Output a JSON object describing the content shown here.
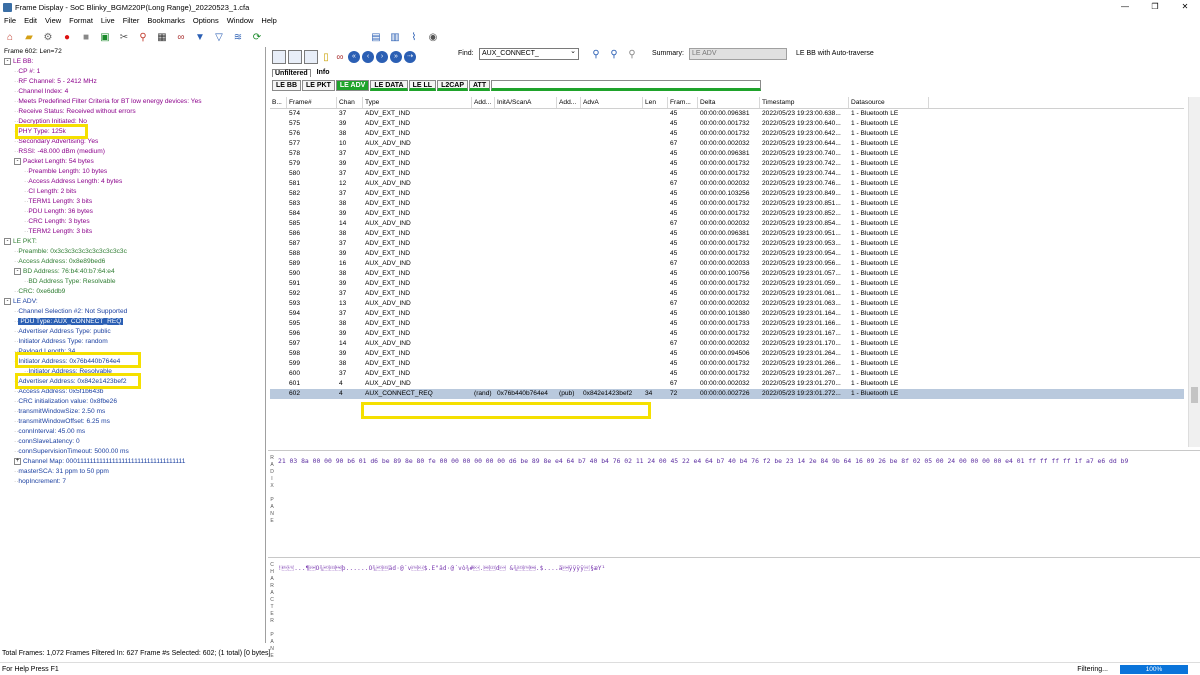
{
  "window": {
    "title": "Frame Display - SoC Blinky_BGM220P(Long Range)_20220523_1.cfa",
    "minimize": "—",
    "maximize": "❐",
    "close": "✕"
  },
  "menu": [
    "File",
    "Edit",
    "View",
    "Format",
    "Live",
    "Filter",
    "Bookmarks",
    "Options",
    "Window",
    "Help"
  ],
  "toolbar_icons": [
    "home-icon",
    "open-folder-icon",
    "settings-icon",
    "record-icon",
    "stop-icon",
    "save-icon",
    "scissors-icon",
    "search-icon",
    "table-icon",
    "binoculars-icon",
    "filter-icon",
    "filter-clear-icon",
    "layers-icon",
    "refresh-icon"
  ],
  "tree": [
    {
      "text": "Frame 602:  Len=72",
      "color": "black",
      "indent": 0,
      "box": ""
    },
    {
      "text": "LE BB:",
      "color": "purple",
      "indent": 0,
      "box": "-"
    },
    {
      "text": "CP #: 1",
      "color": "purple",
      "indent": 1,
      "box": ""
    },
    {
      "text": "RF Channel:  5 - 2412 MHz",
      "color": "purple",
      "indent": 1,
      "box": ""
    },
    {
      "text": "Channel Index:  4",
      "color": "purple",
      "indent": 1,
      "box": ""
    },
    {
      "text": "Meets Predefined Filter Criteria for BT low energy devices: Yes",
      "color": "purple",
      "indent": 1,
      "box": ""
    },
    {
      "text": "Receive Status: Received without errors",
      "color": "purple",
      "indent": 1,
      "box": ""
    },
    {
      "text": "Decryption Initiated: No",
      "color": "purple",
      "indent": 1,
      "box": ""
    },
    {
      "text": "PHY Type: 125k",
      "color": "purple",
      "indent": 1,
      "box": ""
    },
    {
      "text": "Secondary Advertising: Yes",
      "color": "purple",
      "indent": 1,
      "box": ""
    },
    {
      "text": "RSSI: -48.000 dBm (medium)",
      "color": "purple",
      "indent": 1,
      "box": ""
    },
    {
      "text": "Packet Length: 54  bytes",
      "color": "purple",
      "indent": 1,
      "box": "-"
    },
    {
      "text": "Preamble Length: 10 bytes",
      "color": "purple",
      "indent": 2,
      "box": ""
    },
    {
      "text": "Access Address Length: 4 bytes",
      "color": "purple",
      "indent": 2,
      "box": ""
    },
    {
      "text": "CI Length: 2 bits",
      "color": "purple",
      "indent": 2,
      "box": ""
    },
    {
      "text": "TERM1 Length: 3 bits",
      "color": "purple",
      "indent": 2,
      "box": ""
    },
    {
      "text": "PDU Length: 36 bytes",
      "color": "purple",
      "indent": 2,
      "box": ""
    },
    {
      "text": "CRC Length: 3 bytes",
      "color": "purple",
      "indent": 2,
      "box": ""
    },
    {
      "text": "TERM2 Length: 3 bits",
      "color": "purple",
      "indent": 2,
      "box": ""
    },
    {
      "text": "LE PKT:",
      "color": "green",
      "indent": 0,
      "box": "-"
    },
    {
      "text": "Preamble: 0x3c3c3c3c3c3c3c3c3c3c",
      "color": "green",
      "indent": 1,
      "box": ""
    },
    {
      "text": "Access Address: 0x8e89bed6",
      "color": "green",
      "indent": 1,
      "box": ""
    },
    {
      "text": "BD Address: 76:b4:40:b7:64:e4",
      "color": "green",
      "indent": 1,
      "box": "-"
    },
    {
      "text": "BD Address Type: Resolvable",
      "color": "green",
      "indent": 2,
      "box": ""
    },
    {
      "text": "CRC: 0xe6ddb9",
      "color": "green",
      "indent": 1,
      "box": ""
    },
    {
      "text": "LE ADV:",
      "color": "blue",
      "indent": 0,
      "box": "-"
    },
    {
      "text": "Channel Selection #2: Not Supported",
      "color": "blue",
      "indent": 1,
      "box": ""
    },
    {
      "text": "PDU Type: AUX_CONNECT_REQ",
      "color": "blue",
      "indent": 1,
      "box": "",
      "selected": true
    },
    {
      "text": "Advertiser Address Type: public",
      "color": "blue",
      "indent": 1,
      "box": ""
    },
    {
      "text": "Initiator Address Type: random",
      "color": "blue",
      "indent": 1,
      "box": ""
    },
    {
      "text": "Payload Length: 34",
      "color": "blue",
      "indent": 1,
      "box": ""
    },
    {
      "text": "Initiator Address: 0x76b440b764e4",
      "color": "blue",
      "indent": 1,
      "box": ""
    },
    {
      "text": "Initiator Address: Resolvable",
      "color": "blue",
      "indent": 2,
      "box": ""
    },
    {
      "text": "Advertiser Address: 0x842e1423bef2",
      "color": "blue",
      "indent": 1,
      "box": ""
    },
    {
      "text": "Access Address: 0x5f1b643b",
      "color": "blue",
      "indent": 1,
      "box": ""
    },
    {
      "text": "CRC initialization value: 0x8fbe26",
      "color": "blue",
      "indent": 1,
      "box": ""
    },
    {
      "text": "transmitWindowSize: 2.50  ms",
      "color": "blue",
      "indent": 1,
      "box": ""
    },
    {
      "text": "transmitWindowOffset: 6.25  ms",
      "color": "blue",
      "indent": 1,
      "box": ""
    },
    {
      "text": "connInterval: 45.00  ms",
      "color": "blue",
      "indent": 1,
      "box": ""
    },
    {
      "text": "connSlaveLatency: 0",
      "color": "blue",
      "indent": 1,
      "box": ""
    },
    {
      "text": "connSupervisionTimeout: 5000.00  ms",
      "color": "blue",
      "indent": 1,
      "box": ""
    },
    {
      "text": "Channel Map: 0001111111111111111111111111111111111",
      "color": "blue",
      "indent": 1,
      "box": "+"
    },
    {
      "text": "masterSCA: 31 ppm to 50 ppm",
      "color": "blue",
      "indent": 1,
      "box": ""
    },
    {
      "text": "hopIncrement: 7",
      "color": "blue",
      "indent": 1,
      "box": ""
    }
  ],
  "find": {
    "label": "Find:",
    "value": "AUX_CONNECT_"
  },
  "summary": {
    "label": "Summary:",
    "value": "LE ADV",
    "right": "LE BB with Auto-traverse"
  },
  "view_tabs": [
    "Unfiltered",
    "Info"
  ],
  "proto_tabs": [
    "LE BB",
    "LE PKT",
    "LE ADV",
    "LE DATA",
    "LE LL",
    "L2CAP",
    "ATT"
  ],
  "active_proto_tab": "LE ADV",
  "columns": [
    "B...",
    "Frame#",
    "Chan",
    "Type",
    "Add...",
    "InitA/ScanA",
    "Add...",
    "AdvA",
    "Len",
    "Fram...",
    "Delta",
    "Timestamp",
    "Datasource"
  ],
  "rows": [
    [
      "",
      "574",
      "37",
      "ADV_EXT_IND",
      "",
      "",
      "",
      "",
      "",
      "45",
      "00:00:00.096381",
      "2022/05/23 19:23:00.638...",
      "1 - Bluetooth LE"
    ],
    [
      "",
      "575",
      "39",
      "ADV_EXT_IND",
      "",
      "",
      "",
      "",
      "",
      "45",
      "00:00:00.001732",
      "2022/05/23 19:23:00.640...",
      "1 - Bluetooth LE"
    ],
    [
      "",
      "576",
      "38",
      "ADV_EXT_IND",
      "",
      "",
      "",
      "",
      "",
      "45",
      "00:00:00.001732",
      "2022/05/23 19:23:00.642...",
      "1 - Bluetooth LE"
    ],
    [
      "",
      "577",
      "10",
      "AUX_ADV_IND",
      "",
      "",
      "",
      "",
      "",
      "67",
      "00:00:00.002032",
      "2022/05/23 19:23:00.644...",
      "1 - Bluetooth LE"
    ],
    [
      "",
      "578",
      "37",
      "ADV_EXT_IND",
      "",
      "",
      "",
      "",
      "",
      "45",
      "00:00:00.096381",
      "2022/05/23 19:23:00.740...",
      "1 - Bluetooth LE"
    ],
    [
      "",
      "579",
      "39",
      "ADV_EXT_IND",
      "",
      "",
      "",
      "",
      "",
      "45",
      "00:00:00.001732",
      "2022/05/23 19:23:00.742...",
      "1 - Bluetooth LE"
    ],
    [
      "",
      "580",
      "37",
      "ADV_EXT_IND",
      "",
      "",
      "",
      "",
      "",
      "45",
      "00:00:00.001732",
      "2022/05/23 19:23:00.744...",
      "1 - Bluetooth LE"
    ],
    [
      "",
      "581",
      "12",
      "AUX_ADV_IND",
      "",
      "",
      "",
      "",
      "",
      "67",
      "00:00:00.002032",
      "2022/05/23 19:23:00.746...",
      "1 - Bluetooth LE"
    ],
    [
      "",
      "582",
      "37",
      "ADV_EXT_IND",
      "",
      "",
      "",
      "",
      "",
      "45",
      "00:00:00.103256",
      "2022/05/23 19:23:00.849...",
      "1 - Bluetooth LE"
    ],
    [
      "",
      "583",
      "38",
      "ADV_EXT_IND",
      "",
      "",
      "",
      "",
      "",
      "45",
      "00:00:00.001732",
      "2022/05/23 19:23:00.851...",
      "1 - Bluetooth LE"
    ],
    [
      "",
      "584",
      "39",
      "ADV_EXT_IND",
      "",
      "",
      "",
      "",
      "",
      "45",
      "00:00:00.001732",
      "2022/05/23 19:23:00.852...",
      "1 - Bluetooth LE"
    ],
    [
      "",
      "585",
      "14",
      "AUX_ADV_IND",
      "",
      "",
      "",
      "",
      "",
      "67",
      "00:00:00.002032",
      "2022/05/23 19:23:00.854...",
      "1 - Bluetooth LE"
    ],
    [
      "",
      "586",
      "38",
      "ADV_EXT_IND",
      "",
      "",
      "",
      "",
      "",
      "45",
      "00:00:00.096381",
      "2022/05/23 19:23:00.951...",
      "1 - Bluetooth LE"
    ],
    [
      "",
      "587",
      "37",
      "ADV_EXT_IND",
      "",
      "",
      "",
      "",
      "",
      "45",
      "00:00:00.001732",
      "2022/05/23 19:23:00.953...",
      "1 - Bluetooth LE"
    ],
    [
      "",
      "588",
      "39",
      "ADV_EXT_IND",
      "",
      "",
      "",
      "",
      "",
      "45",
      "00:00:00.001732",
      "2022/05/23 19:23:00.954...",
      "1 - Bluetooth LE"
    ],
    [
      "",
      "589",
      "16",
      "AUX_ADV_IND",
      "",
      "",
      "",
      "",
      "",
      "67",
      "00:00:00.002033",
      "2022/05/23 19:23:00.956...",
      "1 - Bluetooth LE"
    ],
    [
      "",
      "590",
      "38",
      "ADV_EXT_IND",
      "",
      "",
      "",
      "",
      "",
      "45",
      "00:00:00.100756",
      "2022/05/23 19:23:01.057...",
      "1 - Bluetooth LE"
    ],
    [
      "",
      "591",
      "39",
      "ADV_EXT_IND",
      "",
      "",
      "",
      "",
      "",
      "45",
      "00:00:00.001732",
      "2022/05/23 19:23:01.059...",
      "1 - Bluetooth LE"
    ],
    [
      "",
      "592",
      "37",
      "ADV_EXT_IND",
      "",
      "",
      "",
      "",
      "",
      "45",
      "00:00:00.001732",
      "2022/05/23 19:23:01.061...",
      "1 - Bluetooth LE"
    ],
    [
      "",
      "593",
      "13",
      "AUX_ADV_IND",
      "",
      "",
      "",
      "",
      "",
      "67",
      "00:00:00.002032",
      "2022/05/23 19:23:01.063...",
      "1 - Bluetooth LE"
    ],
    [
      "",
      "594",
      "37",
      "ADV_EXT_IND",
      "",
      "",
      "",
      "",
      "",
      "45",
      "00:00:00.101380",
      "2022/05/23 19:23:01.164...",
      "1 - Bluetooth LE"
    ],
    [
      "",
      "595",
      "38",
      "ADV_EXT_IND",
      "",
      "",
      "",
      "",
      "",
      "45",
      "00:00:00.001733",
      "2022/05/23 19:23:01.166...",
      "1 - Bluetooth LE"
    ],
    [
      "",
      "596",
      "39",
      "ADV_EXT_IND",
      "",
      "",
      "",
      "",
      "",
      "45",
      "00:00:00.001732",
      "2022/05/23 19:23:01.167...",
      "1 - Bluetooth LE"
    ],
    [
      "",
      "597",
      "14",
      "AUX_ADV_IND",
      "",
      "",
      "",
      "",
      "",
      "67",
      "00:00:00.002032",
      "2022/05/23 19:23:01.170...",
      "1 - Bluetooth LE"
    ],
    [
      "",
      "598",
      "39",
      "ADV_EXT_IND",
      "",
      "",
      "",
      "",
      "",
      "45",
      "00:00:00.094506",
      "2022/05/23 19:23:01.264...",
      "1 - Bluetooth LE"
    ],
    [
      "",
      "599",
      "38",
      "ADV_EXT_IND",
      "",
      "",
      "",
      "",
      "",
      "45",
      "00:00:00.001732",
      "2022/05/23 19:23:01.266...",
      "1 - Bluetooth LE"
    ],
    [
      "",
      "600",
      "37",
      "ADV_EXT_IND",
      "",
      "",
      "",
      "",
      "",
      "45",
      "00:00:00.001732",
      "2022/05/23 19:23:01.267...",
      "1 - Bluetooth LE"
    ],
    [
      "",
      "601",
      "4",
      "AUX_ADV_IND",
      "",
      "",
      "",
      "",
      "",
      "67",
      "00:00:00.002032",
      "2022/05/23 19:23:01.270...",
      "1 - Bluetooth LE"
    ],
    [
      "",
      "602",
      "4",
      "AUX_CONNECT_REQ",
      "(rand)",
      "0x76b440b764e4",
      "(pub)",
      "0x842e1423bef2",
      "34",
      "72",
      "00:00:00.002726",
      "2022/05/23 19:23:01.272...",
      "1 - Bluetooth LE"
    ]
  ],
  "selected_row_index": 28,
  "radix_pane_label": "RADIX PANE",
  "hex": "21 03 8a 00 00 90 b6 01 d6 be 89 8e 80 fe 00 00 00 00 00 00 d6 be 89 8e e4 64 b7 40 b4 76 02 11 24 00 45 22 e4 64 b7 40 b4 76 f2 be 23 14 2e 84 9b 64 16 09 26 be 8f 02 05 00 24 00 00 00 00 e4 01 ff ff ff ff 1f a7 e6 dd b9",
  "char_pane_label": "CHARACTER PANE",
  "chars": "!\u0003...¶\u0001Ö¾þ......Ö¾äd·@´v\u0002\u0011$.E\"äd·@´vò¾#\u0014.d\u0016\t&¾\u0002\u0005.$....ä\u0001ÿÿÿÿ\u001f§æÝ¹",
  "status": {
    "line1": "Total Frames:  1,072   Frames Filtered In:  627   Frame #s Selected:  602; (1 total) [0 bytes]",
    "help": "For Help Press F1",
    "filtering": "Filtering...",
    "progress": "100%",
    "progress_value": 1.0
  }
}
